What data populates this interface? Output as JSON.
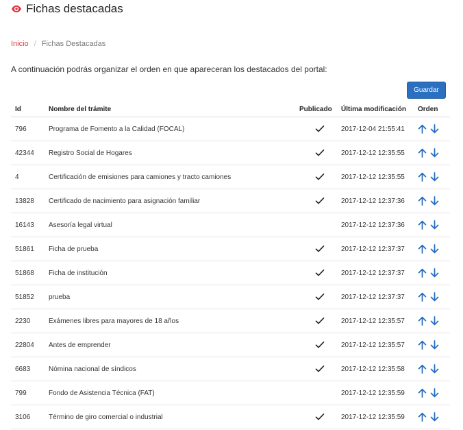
{
  "page": {
    "title": "Fichas destacadas",
    "breadcrumb": {
      "home": "Inicio",
      "separator": "/",
      "current": "Fichas Destacadas"
    },
    "intro": "A continuación podrás organizar el orden en que apareceran los destacados del portal:",
    "save_label": "Guardar"
  },
  "colors": {
    "accent_red": "#e0303f",
    "primary_blue": "#2a6fc0",
    "arrow_blue": "#2a6fc0"
  },
  "icons": {
    "title": "eye-icon",
    "published": "check-icon",
    "move_up": "arrow-up-icon",
    "move_down": "arrow-down-icon"
  },
  "table": {
    "headers": {
      "id": "Id",
      "name": "Nombre del trámite",
      "published": "Publicado",
      "modified": "Última modificación",
      "order": "Orden"
    },
    "rows": [
      {
        "id": "796",
        "name": "Programa de Fomento a la Calidad (FOCAL)",
        "published": true,
        "modified": "2017-12-04 21:55:41"
      },
      {
        "id": "42344",
        "name": "Registro Social de Hogares",
        "published": true,
        "modified": "2017-12-12 12:35:55"
      },
      {
        "id": "4",
        "name": "Certificación de emisiones para camiones y tracto camiones",
        "published": true,
        "modified": "2017-12-12 12:35:55"
      },
      {
        "id": "13828",
        "name": "Certificado de nacimiento para asignación familiar",
        "published": true,
        "modified": "2017-12-12 12:37:36"
      },
      {
        "id": "16143",
        "name": "Asesoría legal virtual",
        "published": false,
        "modified": "2017-12-12 12:37:36"
      },
      {
        "id": "51861",
        "name": "Ficha de prueba",
        "published": true,
        "modified": "2017-12-12 12:37:37"
      },
      {
        "id": "51868",
        "name": "Ficha de institución",
        "published": true,
        "modified": "2017-12-12 12:37:37"
      },
      {
        "id": "51852",
        "name": "prueba",
        "published": true,
        "modified": "2017-12-12 12:37:37"
      },
      {
        "id": "2230",
        "name": "Exámenes libres para mayores de 18 años",
        "published": true,
        "modified": "2017-12-12 12:35:57"
      },
      {
        "id": "22804",
        "name": "Antes de emprender",
        "published": true,
        "modified": "2017-12-12 12:35:57"
      },
      {
        "id": "6683",
        "name": "Nómina nacional de síndicos",
        "published": true,
        "modified": "2017-12-12 12:35:58"
      },
      {
        "id": "799",
        "name": "Fondo de Asistencia Técnica (FAT)",
        "published": false,
        "modified": "2017-12-12 12:35:59"
      },
      {
        "id": "3106",
        "name": "Término de giro comercial o industrial",
        "published": true,
        "modified": "2017-12-12 12:35:59"
      }
    ]
  }
}
